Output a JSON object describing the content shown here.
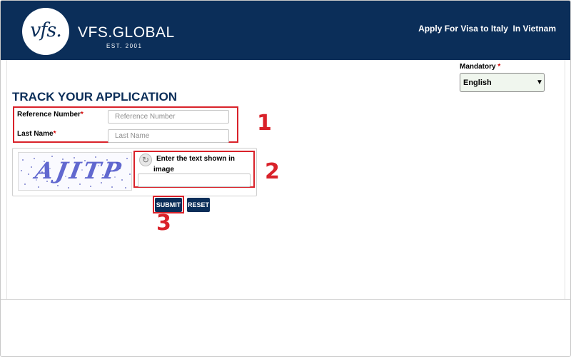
{
  "header": {
    "logo_mark": "vfs.",
    "brand_name": "VFS.GLOBAL",
    "brand_est": "EST. 2001",
    "apply_text": "Apply For Visa to Italy  In Vietnam"
  },
  "language": {
    "mandatory_label": "Mandatory",
    "required_marker": "*",
    "selected": "English"
  },
  "page": {
    "title": "TRACK YOUR APPLICATION"
  },
  "form": {
    "reference_label": "Reference Number",
    "reference_placeholder": "Reference Number",
    "reference_value": "",
    "lastname_label": "Last Name",
    "lastname_placeholder": "Last Name",
    "lastname_value": "",
    "required_marker": "*"
  },
  "captcha": {
    "image_text": "AJITP",
    "instruction_line1": "Enter the text shown in",
    "instruction_line2": "image",
    "refresh_icon": "refresh-icon",
    "input_value": ""
  },
  "buttons": {
    "submit": "SUBMIT",
    "reset": "RESET"
  },
  "annotations": {
    "step1": "1",
    "step2": "2",
    "step3": "3"
  },
  "colors": {
    "brand_navy": "#0b2e59",
    "highlight_red": "#d9222a",
    "required_red": "#d40000"
  }
}
